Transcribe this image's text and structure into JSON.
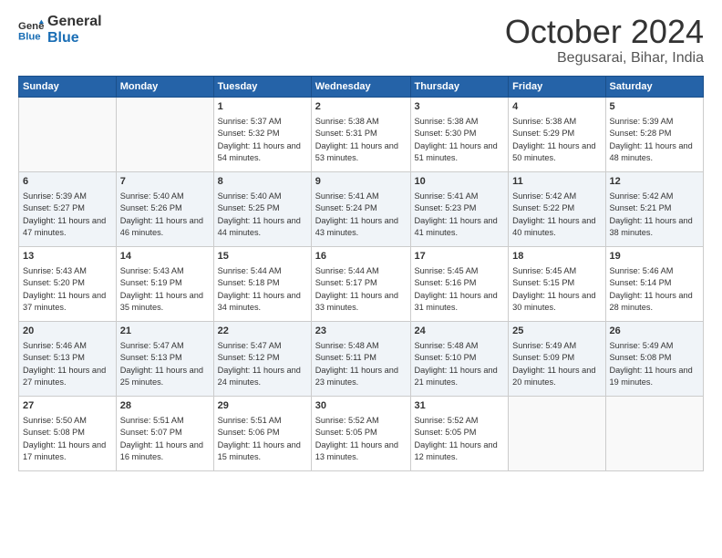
{
  "header": {
    "logo": {
      "line1": "General",
      "line2": "Blue"
    },
    "title": "October 2024",
    "location": "Begusarai, Bihar, India"
  },
  "calendar": {
    "headers": [
      "Sunday",
      "Monday",
      "Tuesday",
      "Wednesday",
      "Thursday",
      "Friday",
      "Saturday"
    ],
    "weeks": [
      [
        {
          "day": "",
          "empty": true
        },
        {
          "day": "",
          "empty": true
        },
        {
          "day": "1",
          "sunrise": "5:37 AM",
          "sunset": "5:32 PM",
          "daylight": "11 hours and 54 minutes."
        },
        {
          "day": "2",
          "sunrise": "5:38 AM",
          "sunset": "5:31 PM",
          "daylight": "11 hours and 53 minutes."
        },
        {
          "day": "3",
          "sunrise": "5:38 AM",
          "sunset": "5:30 PM",
          "daylight": "11 hours and 51 minutes."
        },
        {
          "day": "4",
          "sunrise": "5:38 AM",
          "sunset": "5:29 PM",
          "daylight": "11 hours and 50 minutes."
        },
        {
          "day": "5",
          "sunrise": "5:39 AM",
          "sunset": "5:28 PM",
          "daylight": "11 hours and 48 minutes."
        }
      ],
      [
        {
          "day": "6",
          "sunrise": "5:39 AM",
          "sunset": "5:27 PM",
          "daylight": "11 hours and 47 minutes."
        },
        {
          "day": "7",
          "sunrise": "5:40 AM",
          "sunset": "5:26 PM",
          "daylight": "11 hours and 46 minutes."
        },
        {
          "day": "8",
          "sunrise": "5:40 AM",
          "sunset": "5:25 PM",
          "daylight": "11 hours and 44 minutes."
        },
        {
          "day": "9",
          "sunrise": "5:41 AM",
          "sunset": "5:24 PM",
          "daylight": "11 hours and 43 minutes."
        },
        {
          "day": "10",
          "sunrise": "5:41 AM",
          "sunset": "5:23 PM",
          "daylight": "11 hours and 41 minutes."
        },
        {
          "day": "11",
          "sunrise": "5:42 AM",
          "sunset": "5:22 PM",
          "daylight": "11 hours and 40 minutes."
        },
        {
          "day": "12",
          "sunrise": "5:42 AM",
          "sunset": "5:21 PM",
          "daylight": "11 hours and 38 minutes."
        }
      ],
      [
        {
          "day": "13",
          "sunrise": "5:43 AM",
          "sunset": "5:20 PM",
          "daylight": "11 hours and 37 minutes."
        },
        {
          "day": "14",
          "sunrise": "5:43 AM",
          "sunset": "5:19 PM",
          "daylight": "11 hours and 35 minutes."
        },
        {
          "day": "15",
          "sunrise": "5:44 AM",
          "sunset": "5:18 PM",
          "daylight": "11 hours and 34 minutes."
        },
        {
          "day": "16",
          "sunrise": "5:44 AM",
          "sunset": "5:17 PM",
          "daylight": "11 hours and 33 minutes."
        },
        {
          "day": "17",
          "sunrise": "5:45 AM",
          "sunset": "5:16 PM",
          "daylight": "11 hours and 31 minutes."
        },
        {
          "day": "18",
          "sunrise": "5:45 AM",
          "sunset": "5:15 PM",
          "daylight": "11 hours and 30 minutes."
        },
        {
          "day": "19",
          "sunrise": "5:46 AM",
          "sunset": "5:14 PM",
          "daylight": "11 hours and 28 minutes."
        }
      ],
      [
        {
          "day": "20",
          "sunrise": "5:46 AM",
          "sunset": "5:13 PM",
          "daylight": "11 hours and 27 minutes."
        },
        {
          "day": "21",
          "sunrise": "5:47 AM",
          "sunset": "5:13 PM",
          "daylight": "11 hours and 25 minutes."
        },
        {
          "day": "22",
          "sunrise": "5:47 AM",
          "sunset": "5:12 PM",
          "daylight": "11 hours and 24 minutes."
        },
        {
          "day": "23",
          "sunrise": "5:48 AM",
          "sunset": "5:11 PM",
          "daylight": "11 hours and 23 minutes."
        },
        {
          "day": "24",
          "sunrise": "5:48 AM",
          "sunset": "5:10 PM",
          "daylight": "11 hours and 21 minutes."
        },
        {
          "day": "25",
          "sunrise": "5:49 AM",
          "sunset": "5:09 PM",
          "daylight": "11 hours and 20 minutes."
        },
        {
          "day": "26",
          "sunrise": "5:49 AM",
          "sunset": "5:08 PM",
          "daylight": "11 hours and 19 minutes."
        }
      ],
      [
        {
          "day": "27",
          "sunrise": "5:50 AM",
          "sunset": "5:08 PM",
          "daylight": "11 hours and 17 minutes."
        },
        {
          "day": "28",
          "sunrise": "5:51 AM",
          "sunset": "5:07 PM",
          "daylight": "11 hours and 16 minutes."
        },
        {
          "day": "29",
          "sunrise": "5:51 AM",
          "sunset": "5:06 PM",
          "daylight": "11 hours and 15 minutes."
        },
        {
          "day": "30",
          "sunrise": "5:52 AM",
          "sunset": "5:05 PM",
          "daylight": "11 hours and 13 minutes."
        },
        {
          "day": "31",
          "sunrise": "5:52 AM",
          "sunset": "5:05 PM",
          "daylight": "11 hours and 12 minutes."
        },
        {
          "day": "",
          "empty": true
        },
        {
          "day": "",
          "empty": true
        }
      ]
    ]
  }
}
